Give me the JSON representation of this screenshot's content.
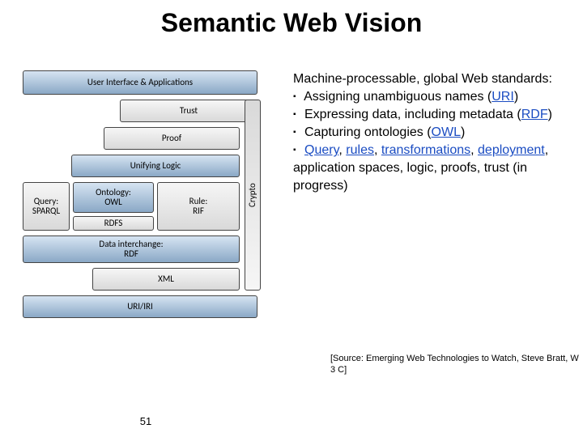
{
  "title": "Semantic Web Vision",
  "stack": {
    "ui": "User Interface & Applications",
    "trust": "Trust",
    "proof": "Proof",
    "logic": "Unifying Logic",
    "owl": "Ontology:\nOWL",
    "sparql": "Query:\nSPARQL",
    "rdfs": "RDFS",
    "rif": "Rule:\nRIF",
    "rdf": "Data interchange:\nRDF",
    "xml": "XML",
    "uri": "URI/IRI",
    "crypto": "Crypto"
  },
  "intro": "Machine-processable, global Web standards:",
  "bullets": {
    "b1a": "Assigning unambiguous names (",
    "b1link": "URI",
    "b1b": ")",
    "b2a": "Expressing data, including metadata (",
    "b2link": "RDF",
    "b2b": ")",
    "b3a": "Capturing ontologies (",
    "b3link": "OWL",
    "b3b": ")",
    "b4_query": "Query",
    "b4_comma1": ", ",
    "b4_rules": "rules",
    "b4_comma2": ", ",
    "b4_trans": "transformations",
    "b4_comma3": ", ",
    "b4_deploy": "deployment",
    "b4_tail": ", application spaces, logic, proofs, trust (in progress)"
  },
  "source": "[Source: Emerging Web Technologies to Watch, Steve Bratt, W 3 C]",
  "page": "51"
}
